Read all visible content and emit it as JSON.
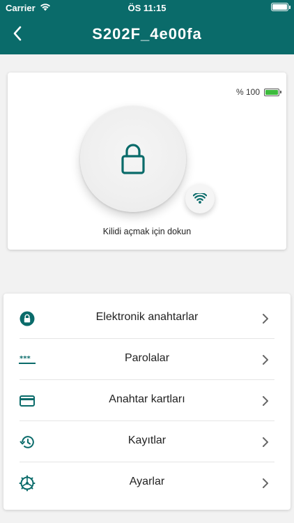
{
  "status_bar": {
    "carrier": "Carrier",
    "time": "ÖS 11:15"
  },
  "nav": {
    "title": "S202F_4e00fa",
    "back_icon": "chevron-left-icon"
  },
  "lock_card": {
    "battery_label": "% 100",
    "battery_level": 1.0,
    "lock_icon": "lock-icon",
    "wifi_icon": "wifi-icon",
    "hint": "Kilidi açmak için dokun"
  },
  "menu": {
    "items": [
      {
        "label": "Elektronik anahtarlar",
        "icon": "lock-circle-icon"
      },
      {
        "label": "Parolalar",
        "icon": "password-icon"
      },
      {
        "label": "Anahtar kartları",
        "icon": "card-icon"
      },
      {
        "label": "Kayıtlar",
        "icon": "history-icon"
      },
      {
        "label": "Ayarlar",
        "icon": "settings-icon"
      }
    ]
  },
  "colors": {
    "primary": "#0a6b6a",
    "battery_green": "#3dbb3d",
    "background": "#f2f2f2"
  }
}
